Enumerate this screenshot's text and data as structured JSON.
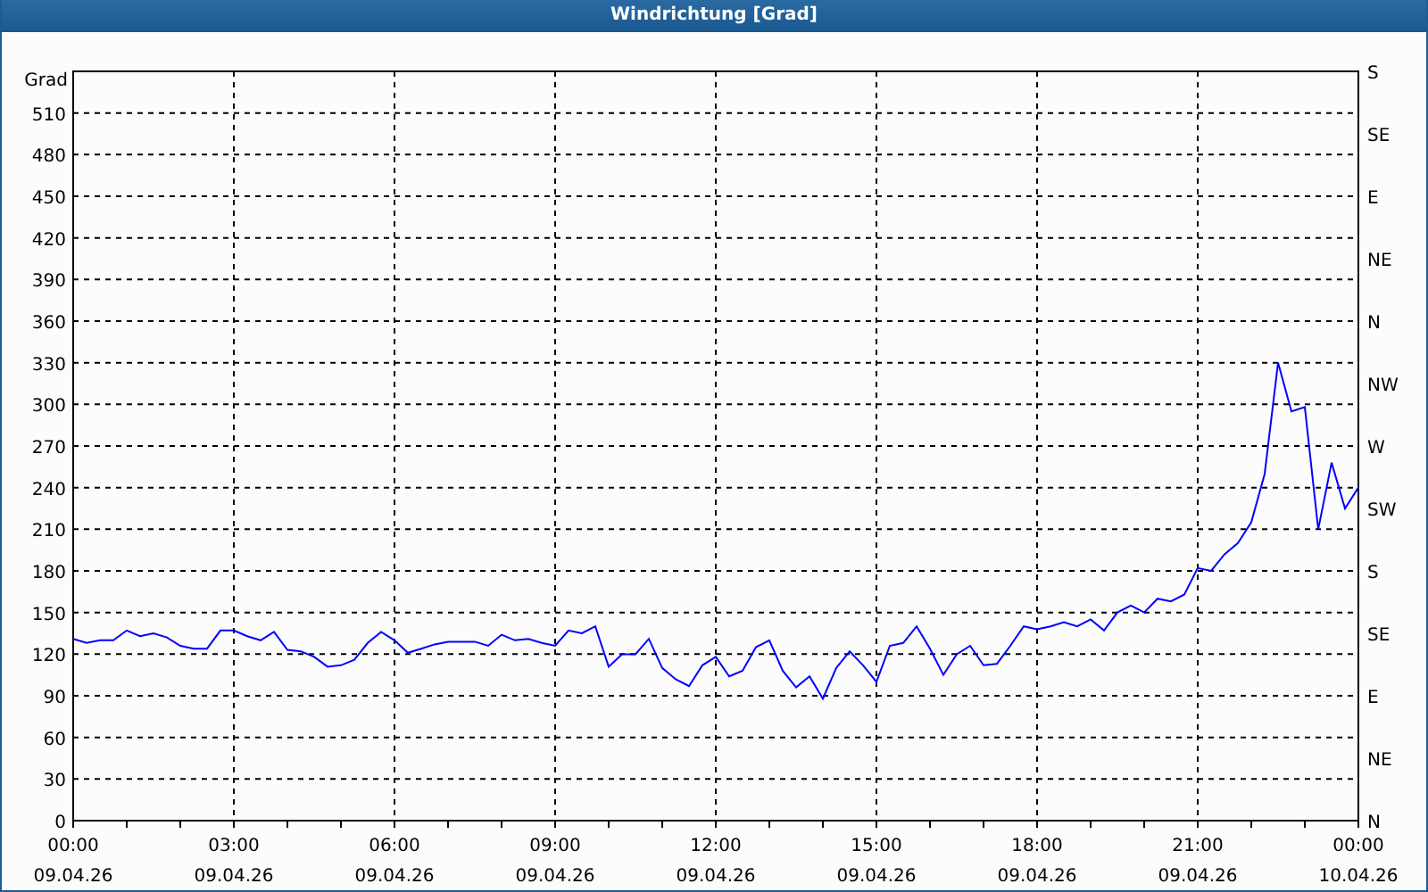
{
  "window": {
    "title": "Windrichtung [Grad]"
  },
  "chart": {
    "chart_data": {
      "type": "line",
      "ylabel": "Grad",
      "xlim": [
        0,
        24
      ],
      "ylim": [
        0,
        540
      ],
      "grid": true,
      "x": [
        0,
        0.25,
        0.5,
        0.75,
        1,
        1.25,
        1.5,
        1.75,
        2,
        2.25,
        2.5,
        2.75,
        3,
        3.25,
        3.5,
        3.75,
        4,
        4.25,
        4.5,
        4.75,
        5,
        5.25,
        5.5,
        5.75,
        6,
        6.25,
        6.5,
        6.75,
        7,
        7.25,
        7.5,
        7.75,
        8,
        8.25,
        8.5,
        8.75,
        9,
        9.25,
        9.5,
        9.75,
        10,
        10.25,
        10.5,
        10.75,
        11,
        11.25,
        11.5,
        11.75,
        12,
        12.25,
        12.5,
        12.75,
        13,
        13.25,
        13.5,
        13.75,
        14,
        14.25,
        14.5,
        14.75,
        15,
        15.25,
        15.5,
        15.75,
        16,
        16.25,
        16.5,
        16.75,
        17,
        17.25,
        17.5,
        17.75,
        18,
        18.25,
        18.5,
        18.75,
        19,
        19.25,
        19.5,
        19.75,
        20,
        20.25,
        20.5,
        20.75,
        21,
        21.25,
        21.5,
        21.75,
        22,
        22.25,
        22.5,
        22.75,
        23,
        23.25,
        23.5,
        23.75,
        24
      ],
      "series": [
        {
          "color": "#0000ff",
          "values": [
            131,
            128,
            130,
            130,
            137,
            133,
            135,
            132,
            126,
            124,
            124,
            137,
            137,
            133,
            130,
            136,
            123,
            122,
            118,
            111,
            112,
            116,
            128,
            136,
            130,
            121,
            124,
            127,
            129,
            129,
            129,
            126,
            134,
            130,
            131,
            128,
            126,
            137,
            135,
            140,
            111,
            120,
            120,
            131,
            110,
            102,
            97,
            112,
            118,
            104,
            108,
            125,
            130,
            108,
            96,
            104,
            88,
            110,
            122,
            112,
            100,
            126,
            128,
            140,
            124,
            105,
            120,
            126,
            112,
            113,
            126,
            140,
            138,
            140,
            143,
            140,
            145,
            137,
            150,
            155,
            150,
            160,
            158,
            163,
            182,
            180,
            192,
            200,
            215,
            250,
            330,
            295,
            298,
            210,
            258,
            225,
            240
          ]
        }
      ],
      "yticks": [
        0,
        30,
        60,
        90,
        120,
        150,
        180,
        210,
        240,
        270,
        300,
        330,
        360,
        390,
        420,
        450,
        480,
        510
      ],
      "xticks": [
        {
          "value": 0,
          "label": "00:00"
        },
        {
          "value": 3,
          "label": "03:00"
        },
        {
          "value": 6,
          "label": "06:00"
        },
        {
          "value": 9,
          "label": "09:00"
        },
        {
          "value": 12,
          "label": "12:00"
        },
        {
          "value": 15,
          "label": "15:00"
        },
        {
          "value": 18,
          "label": "18:00"
        },
        {
          "value": 21,
          "label": "21:00"
        },
        {
          "value": 24,
          "label": "00:00"
        }
      ]
    },
    "x_dates": [
      "09.04.26",
      "09.04.26",
      "09.04.26",
      "09.04.26",
      "09.04.26",
      "09.04.26",
      "09.04.26",
      "09.04.26",
      "10.04.26"
    ],
    "compass_labels": [
      "S",
      "SE",
      "E",
      "NE",
      "N",
      "NW",
      "W",
      "SW",
      "S",
      "SE",
      "E",
      "NE",
      "N"
    ]
  }
}
